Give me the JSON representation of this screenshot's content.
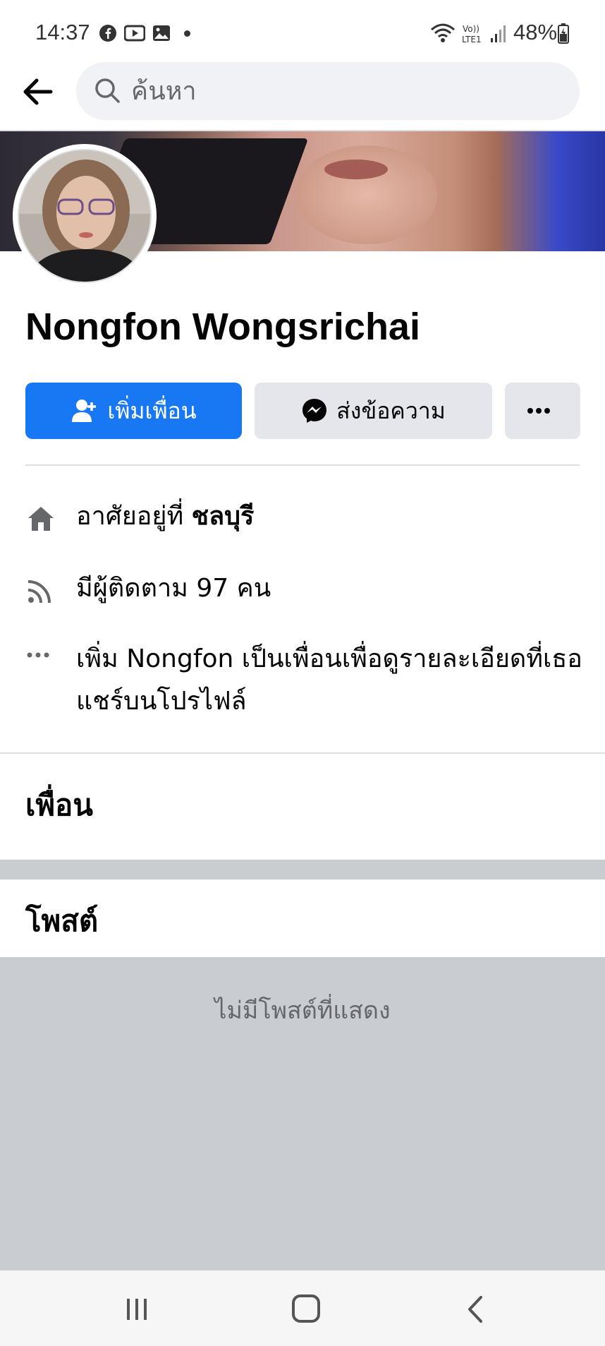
{
  "status_bar": {
    "time": "14:37",
    "battery": "48%",
    "icons": [
      "facebook-icon",
      "youtube-icon",
      "gallery-icon",
      "wifi-icon",
      "lte-signal-icon",
      "battery-icon"
    ]
  },
  "search": {
    "placeholder": "ค้นหา"
  },
  "profile": {
    "name": "Nongfon Wongsrichai"
  },
  "actions": {
    "add_friend_label": "เพิ่มเพื่อน",
    "message_label": "ส่งข้อความ"
  },
  "intro": {
    "lives_in_prefix": "อาศัยอยู่ที่ ",
    "lives_in_place": "ชลบุรี",
    "followers": "มีผู้ติดตาม 97 คน",
    "add_friend_note": "เพิ่ม Nongfon เป็นเพื่อนเพื่อดูรายละเอียดที่เธอแชร์บนโปรไฟล์"
  },
  "sections": {
    "friends_title": "เพื่อน",
    "posts_title": "โพสต์",
    "no_posts": "ไม่มีโพสต์ที่แสดง"
  },
  "colors": {
    "primary": "#1877f2",
    "secondary_button": "#e4e6eb",
    "empty_bg": "#c9ccd1"
  }
}
